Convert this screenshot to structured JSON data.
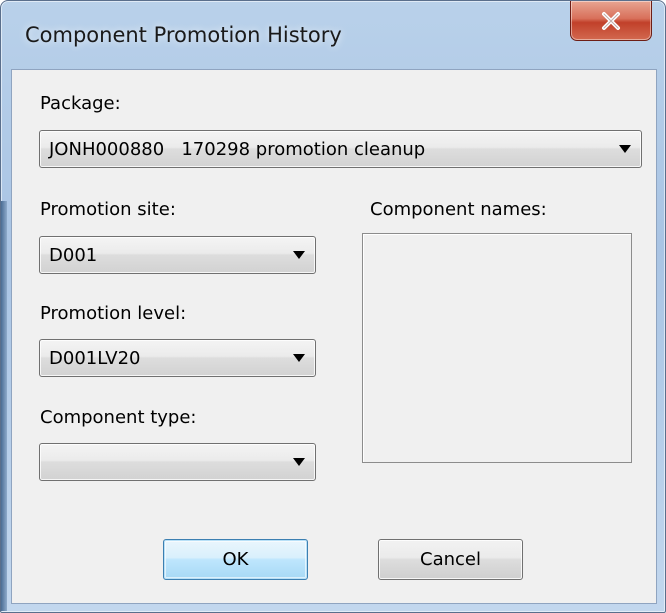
{
  "window": {
    "title": "Component Promotion History",
    "close_icon": "close-icon"
  },
  "form": {
    "package": {
      "label": "Package:",
      "value": "JONH000880   170298 promotion cleanup"
    },
    "promotion_site": {
      "label": "Promotion site:",
      "value": "D001"
    },
    "promotion_level": {
      "label": "Promotion level:",
      "value": "D001LV20"
    },
    "component_type": {
      "label": "Component type:",
      "value": ""
    },
    "component_names": {
      "label": "Component names:",
      "items": []
    }
  },
  "buttons": {
    "ok_label": "OK",
    "cancel_label": "Cancel"
  },
  "colors": {
    "titlebar": "#b9d1ea",
    "client_bg": "#f0f0f0",
    "close_button": "#c1402a",
    "default_button_border": "#3c7fb1"
  }
}
